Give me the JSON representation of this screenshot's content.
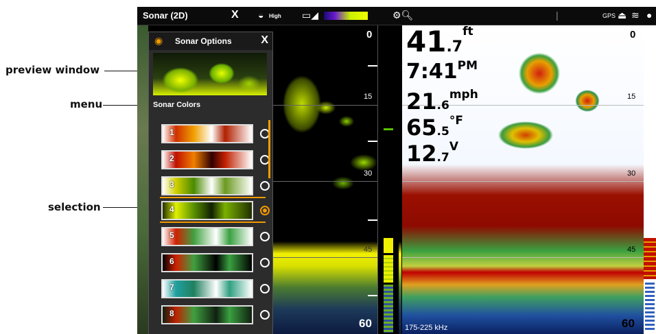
{
  "callouts": {
    "preview": "preview window",
    "menu": "menu",
    "selection": "selection"
  },
  "topbar": {
    "title": "Sonar (2D)",
    "close_glyph": "X",
    "power_label": "High",
    "icons": [
      "close-icon",
      "transducer-icon",
      "battery-signal-icon",
      "palette-icon",
      "zoom-search-icon",
      "gps-icon",
      "radar-icon",
      "waves-icon"
    ]
  },
  "menu": {
    "title": "Sonar Options",
    "close_glyph": "X",
    "section_title": "Sonar Colors",
    "options": [
      {
        "num": "1",
        "selected": false
      },
      {
        "num": "2",
        "selected": false
      },
      {
        "num": "3",
        "selected": false
      },
      {
        "num": "4",
        "selected": true
      },
      {
        "num": "5",
        "selected": false
      },
      {
        "num": "6",
        "selected": false
      },
      {
        "num": "7",
        "selected": false
      },
      {
        "num": "8",
        "selected": false
      }
    ]
  },
  "left_depths": [
    "0",
    "15",
    "30",
    "45",
    "60"
  ],
  "right_depths": [
    "0",
    "15",
    "30",
    "45",
    "60"
  ],
  "readouts": {
    "depth": {
      "int": "41",
      "dec": ".7",
      "unit": "ft"
    },
    "time": {
      "value": "7:41",
      "unit": "PM"
    },
    "speed": {
      "int": "21",
      "dec": ".6",
      "unit": "mph"
    },
    "temp": {
      "int": "65",
      "dec": ".5",
      "unit": "°F"
    },
    "voltage": {
      "int": "12",
      "dec": ".7",
      "unit": "V"
    }
  },
  "frequency": "175-225 kHz",
  "colors": {
    "accent": "#f29a00",
    "menu_bg": "#2c2c2c"
  }
}
